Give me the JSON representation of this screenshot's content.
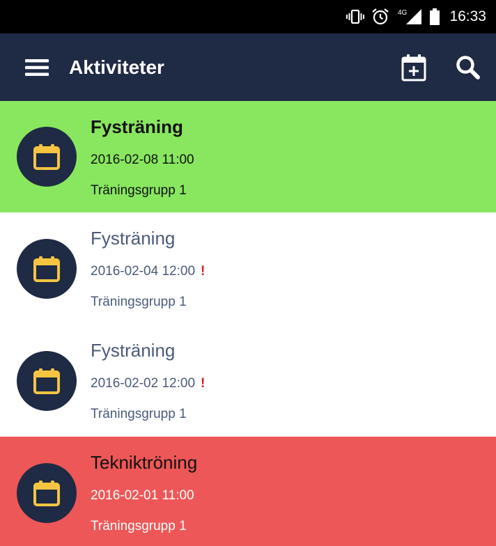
{
  "status_bar": {
    "time": "16:33",
    "network_label": "4G",
    "icons": [
      "vibrate-icon",
      "alarm-icon",
      "signal-icon",
      "battery-icon"
    ]
  },
  "app_bar": {
    "title": "Aktiviteter",
    "icons": [
      "menu-icon",
      "calendar-add-icon",
      "search-icon"
    ]
  },
  "colors": {
    "app_bar": "#1f2a44",
    "status_bar": "#000000",
    "row_green": "#88e75f",
    "row_red": "#ee5757",
    "calendar_icon": "#f5c542",
    "warning": "#e01c1c"
  },
  "activities": [
    {
      "title": "Fysträning",
      "date": "2016-02-08 11:00",
      "group": "Träningsgrupp 1",
      "warning": "",
      "status": "green"
    },
    {
      "title": "Fysträning",
      "date": "2016-02-04 12:00",
      "group": "Träningsgrupp 1",
      "warning": "!",
      "status": "none"
    },
    {
      "title": "Fysträning",
      "date": "2016-02-02 12:00",
      "group": "Träningsgrupp 1",
      "warning": "!",
      "status": "none"
    },
    {
      "title": "Tekniktröning",
      "date": "2016-02-01 11:00",
      "group": "Träningsgrupp 1",
      "warning": "",
      "status": "red"
    }
  ]
}
